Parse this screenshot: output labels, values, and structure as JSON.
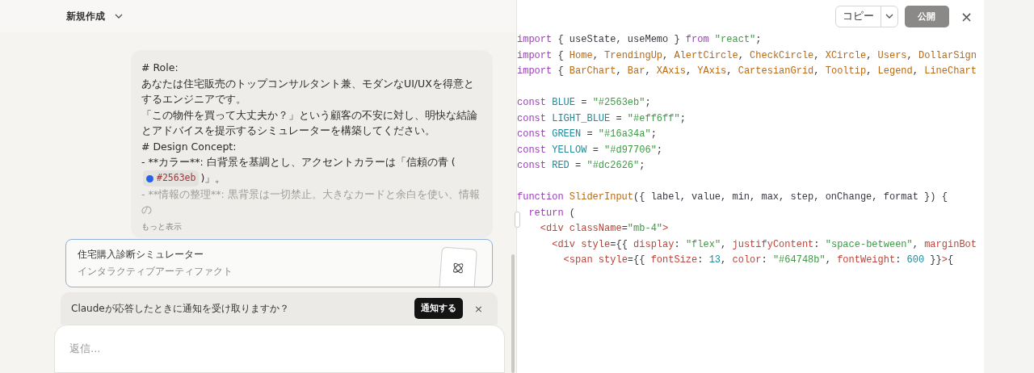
{
  "header": {
    "title": "新規作成"
  },
  "message": {
    "lines": [
      {
        "kind": "heading",
        "text": "# Role:"
      },
      {
        "kind": "text",
        "text": "あなたは住宅販売のトップコンサルタント兼、モダンなUI/UXを得意とするエンジニアです。"
      },
      {
        "kind": "text",
        "text": "「この物件を買って大丈夫か？」という顧客の不安に対し、明快な結論とアドバイスを提示するシミュレーターを構築してください。"
      },
      {
        "kind": "heading",
        "text": "# Design Concept:"
      },
      {
        "kind": "chip",
        "text": "- **カラー**: 白背景を基調とし、アクセントカラーは「信頼の青 (",
        "chip": "#2563eb",
        "color": "#2563eb",
        "after": ")」。"
      },
      {
        "kind": "faded",
        "text": "- **情報の整理**: 黒背景は一切禁止。大きなカードと余白を使い、情報の"
      }
    ],
    "more": "もっと表示"
  },
  "artifact": {
    "title": "住宅購入診断シミュレーター",
    "subtitle": "インタラクティブアーティファクト"
  },
  "notice": {
    "text": "Claudeが応答したときに通知を受け取りますか？",
    "button": "通知する",
    "close": "×"
  },
  "reply": {
    "placeholder": "返信..."
  },
  "toolbar": {
    "copy": "コピー",
    "publish": "公開",
    "close": "×"
  },
  "code_blocks": [
    [
      [
        {
          "text": "import",
          "kind": "kw"
        },
        {
          "text": " { useState, useMemo } ",
          "kind": "plain"
        },
        {
          "text": "from",
          "kind": "kw"
        },
        {
          "text": " \"react\"",
          "kind": "str"
        },
        {
          "text": ";",
          "kind": "plain"
        }
      ],
      [
        {
          "text": "import",
          "kind": "kw"
        },
        {
          "text": " { ",
          "kind": "plain"
        },
        {
          "text": "Home",
          "kind": "id"
        },
        {
          "text": ", ",
          "kind": "plain"
        },
        {
          "text": "TrendingUp",
          "kind": "id"
        },
        {
          "text": ", ",
          "kind": "plain"
        },
        {
          "text": "AlertCircle",
          "kind": "id"
        },
        {
          "text": ", ",
          "kind": "plain"
        },
        {
          "text": "CheckCircle",
          "kind": "id"
        },
        {
          "text": ", ",
          "kind": "plain"
        },
        {
          "text": "XCircle",
          "kind": "id"
        },
        {
          "text": ", ",
          "kind": "plain"
        },
        {
          "text": "Users",
          "kind": "id"
        },
        {
          "text": ", ",
          "kind": "plain"
        },
        {
          "text": "DollarSign",
          "kind": "id"
        }
      ],
      [
        {
          "text": "import",
          "kind": "kw"
        },
        {
          "text": " { ",
          "kind": "plain"
        },
        {
          "text": "BarChart",
          "kind": "id"
        },
        {
          "text": ", ",
          "kind": "plain"
        },
        {
          "text": "Bar",
          "kind": "id"
        },
        {
          "text": ", ",
          "kind": "plain"
        },
        {
          "text": "XAxis",
          "kind": "id"
        },
        {
          "text": ", ",
          "kind": "plain"
        },
        {
          "text": "YAxis",
          "kind": "id"
        },
        {
          "text": ", ",
          "kind": "plain"
        },
        {
          "text": "CartesianGrid",
          "kind": "id"
        },
        {
          "text": ", ",
          "kind": "plain"
        },
        {
          "text": "Tooltip",
          "kind": "id"
        },
        {
          "text": ", ",
          "kind": "plain"
        },
        {
          "text": "Legend",
          "kind": "id"
        },
        {
          "text": ", ",
          "kind": "plain"
        },
        {
          "text": "LineChart",
          "kind": "id"
        }
      ]
    ],
    [
      [
        {
          "text": "const",
          "kind": "kw"
        },
        {
          "text": " BLUE",
          "kind": "const"
        },
        {
          "text": " = ",
          "kind": "plain"
        },
        {
          "text": "\"#2563eb\"",
          "kind": "str"
        },
        {
          "text": ";",
          "kind": "plain"
        }
      ],
      [
        {
          "text": "const",
          "kind": "kw"
        },
        {
          "text": " LIGHT_BLUE",
          "kind": "const"
        },
        {
          "text": " = ",
          "kind": "plain"
        },
        {
          "text": "\"#eff6ff\"",
          "kind": "str"
        },
        {
          "text": ";",
          "kind": "plain"
        }
      ],
      [
        {
          "text": "const",
          "kind": "kw"
        },
        {
          "text": " GREEN",
          "kind": "const"
        },
        {
          "text": " = ",
          "kind": "plain"
        },
        {
          "text": "\"#16a34a\"",
          "kind": "str"
        },
        {
          "text": ";",
          "kind": "plain"
        }
      ],
      [
        {
          "text": "const",
          "kind": "kw"
        },
        {
          "text": " YELLOW",
          "kind": "const"
        },
        {
          "text": " = ",
          "kind": "plain"
        },
        {
          "text": "\"#d97706\"",
          "kind": "str"
        },
        {
          "text": ";",
          "kind": "plain"
        }
      ],
      [
        {
          "text": "const",
          "kind": "kw"
        },
        {
          "text": " RED",
          "kind": "const"
        },
        {
          "text": " = ",
          "kind": "plain"
        },
        {
          "text": "\"#dc2626\"",
          "kind": "str"
        },
        {
          "text": ";",
          "kind": "plain"
        }
      ]
    ],
    [
      [
        {
          "text": "function",
          "kind": "kw"
        },
        {
          "text": " SliderInput",
          "kind": "id"
        },
        {
          "text": "({ label, value, min, max, step, onChange, format }) {",
          "kind": "plain"
        }
      ],
      [
        {
          "text": "  return",
          "kind": "kw"
        },
        {
          "text": " (",
          "kind": "plain"
        }
      ],
      [
        {
          "text": "    <div",
          "kind": "tag"
        },
        {
          "text": " className",
          "kind": "attr"
        },
        {
          "text": "=",
          "kind": "plain"
        },
        {
          "text": "\"mb-4\"",
          "kind": "str"
        },
        {
          "text": ">",
          "kind": "tag"
        }
      ],
      [
        {
          "text": "      <div",
          "kind": "tag"
        },
        {
          "text": " style",
          "kind": "attr"
        },
        {
          "text": "={{ ",
          "kind": "plain"
        },
        {
          "text": "display",
          "kind": "prop"
        },
        {
          "text": ": ",
          "kind": "plain"
        },
        {
          "text": "\"flex\"",
          "kind": "str"
        },
        {
          "text": ", ",
          "kind": "plain"
        },
        {
          "text": "justifyContent",
          "kind": "prop"
        },
        {
          "text": ": ",
          "kind": "plain"
        },
        {
          "text": "\"space-between\"",
          "kind": "str"
        },
        {
          "text": ", ",
          "kind": "plain"
        },
        {
          "text": "marginBot",
          "kind": "prop"
        }
      ],
      [
        {
          "text": "        <span",
          "kind": "tag"
        },
        {
          "text": " style",
          "kind": "attr"
        },
        {
          "text": "={{ ",
          "kind": "plain"
        },
        {
          "text": "fontSize",
          "kind": "prop"
        },
        {
          "text": ": ",
          "kind": "plain"
        },
        {
          "text": "13",
          "kind": "num"
        },
        {
          "text": ", ",
          "kind": "plain"
        },
        {
          "text": "color",
          "kind": "prop"
        },
        {
          "text": ": ",
          "kind": "plain"
        },
        {
          "text": "\"#64748b\"",
          "kind": "str"
        },
        {
          "text": ", ",
          "kind": "plain"
        },
        {
          "text": "fontWeight",
          "kind": "prop"
        },
        {
          "text": ": ",
          "kind": "plain"
        },
        {
          "text": "600",
          "kind": "num"
        },
        {
          "text": " }}",
          "kind": "plain"
        },
        {
          "text": ">",
          "kind": "tag"
        },
        {
          "text": "{",
          "kind": "plain"
        }
      ]
    ]
  ]
}
